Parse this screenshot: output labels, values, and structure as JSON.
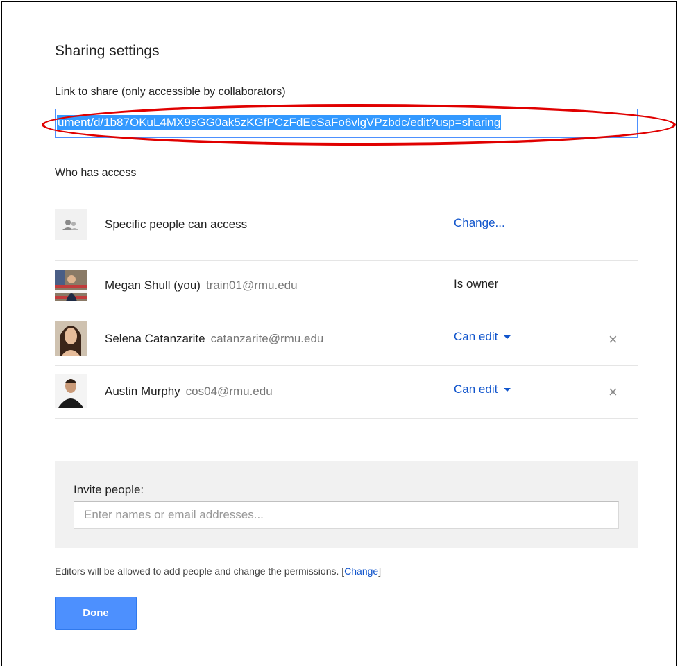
{
  "dialog": {
    "title": "Sharing settings",
    "link_label": "Link to share (only accessible by collaborators)",
    "link_value": "ument/d/1b87OKuL4MX9sGG0ak5zKGfPCzFdEcSaFo6vlgVPzbdc/edit?usp=sharing"
  },
  "access": {
    "heading": "Who has access",
    "general": {
      "label": "Specific people can access",
      "change_link": "Change..."
    },
    "people": [
      {
        "name": "Megan Shull (you)",
        "email": "train01@rmu.edu",
        "role": "Is owner"
      },
      {
        "name": "Selena Catanzarite",
        "email": "catanzarite@rmu.edu",
        "role": "Can edit",
        "remove": "×"
      },
      {
        "name": "Austin Murphy",
        "email": "cos04@rmu.edu",
        "role": "Can edit",
        "remove": "×"
      }
    ]
  },
  "invite": {
    "label": "Invite people:",
    "placeholder": "Enter names or email addresses..."
  },
  "footer": {
    "note": "Editors will be allowed to add people and change the permissions.",
    "change_link": "Change",
    "done_label": "Done"
  },
  "colors": {
    "accent": "#1155cc",
    "button": "#4d90fe",
    "highlight": "#3399ff",
    "annotation": "#e00000"
  },
  "icons": {
    "group": "people-icon",
    "remove": "close-icon",
    "role_menu": "caret-down-icon"
  }
}
